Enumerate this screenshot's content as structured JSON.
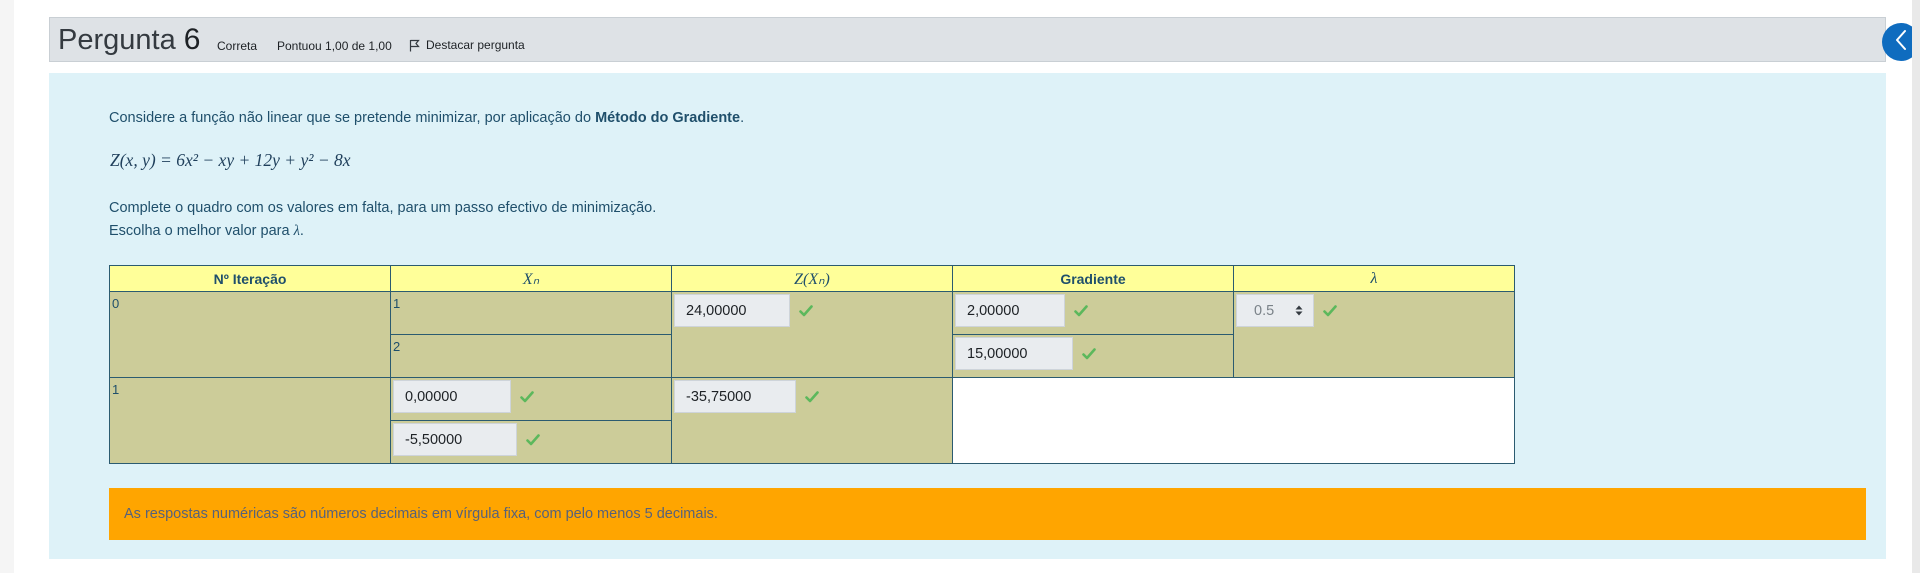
{
  "question": {
    "label": "Pergunta",
    "number": "6",
    "state": "Correta",
    "grade": "Pontuou 1,00 de 1,00",
    "flag_label": "Destacar pergunta"
  },
  "content": {
    "intro_text": "Considere a função não linear que se pretende minimizar, por aplicação do ",
    "intro_bold": "Método do Gradiente",
    "intro_end": ".",
    "formula": "Z(x, y) = 6x² − xy + 12y + y² − 8x",
    "instruction_1": "Complete o quadro com os valores em falta, para um passo efectivo de minimização.",
    "instruction_2": "Escolha o melhor valor para ",
    "lambda_symbol": "λ",
    "instruction_2_end": "."
  },
  "table": {
    "headers": {
      "iteration": "Nº Iteração",
      "xn": "Xₙ",
      "zxn": "Z(Xₙ)",
      "gradient": "Gradiente",
      "lambda": "λ"
    },
    "row0": {
      "iteration": "0",
      "xn_1": "1",
      "xn_2": "2",
      "z": "24,00000",
      "gradient_1": "2,00000",
      "gradient_2": "15,00000",
      "lambda_selected": "0.5"
    },
    "row1": {
      "iteration": "1",
      "xn_1": "0,00000",
      "xn_2": "-5,50000",
      "z": "-35,75000"
    }
  },
  "notice": "As respostas numéricas são números decimais em vírgula fixa, com pelo menos 5 decimais.",
  "colors": {
    "header_bg": "#dee2e6",
    "content_bg": "#def2f8",
    "table_header_bg": "#ffff99",
    "table_cell_bg": "#cccc99",
    "correct_tick": "#5cb85c",
    "notice_bg": "#ffa500",
    "drawer_button": "#0f6cbf"
  },
  "icons": {
    "flag": "flag-icon",
    "correct": "check-icon",
    "drawer": "chevron-left-icon",
    "select": "sort-arrows-icon"
  }
}
